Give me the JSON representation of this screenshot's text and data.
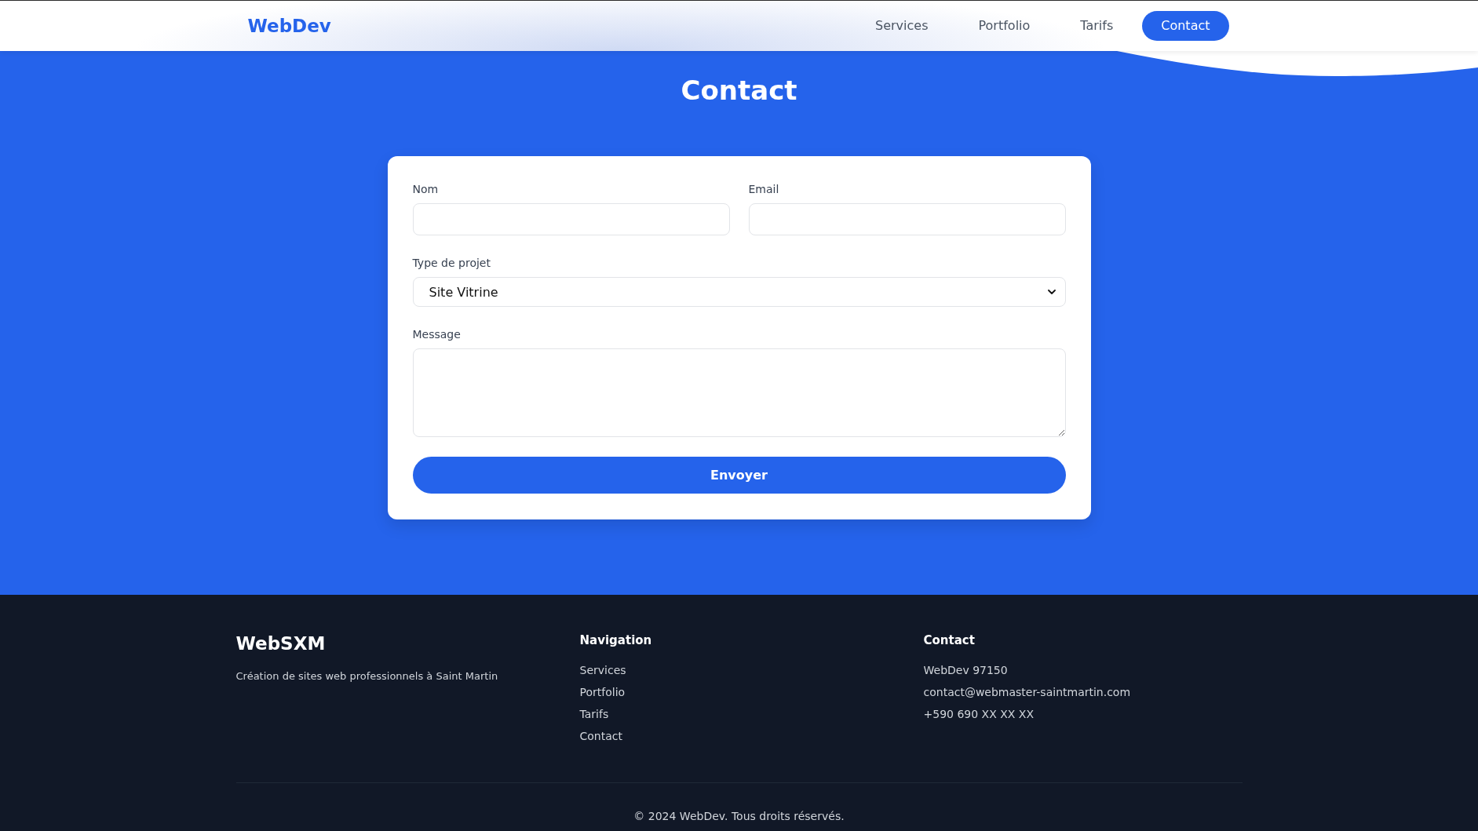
{
  "header": {
    "logo": "WebDev",
    "nav": [
      {
        "label": "Services",
        "selected": false
      },
      {
        "label": "Portfolio",
        "selected": false
      },
      {
        "label": "Tarifs",
        "selected": false
      },
      {
        "label": "Contact",
        "selected": true
      }
    ]
  },
  "page_title": "Contact",
  "form": {
    "fields": [
      {
        "kind": "text",
        "label": "Nom"
      },
      {
        "kind": "text",
        "label": "Email"
      },
      {
        "kind": "select",
        "label": "Type de projet",
        "value": "Site Vitrine"
      },
      {
        "kind": "textarea",
        "label": "Message"
      }
    ],
    "submit": "Envoyer"
  },
  "footer": {
    "brand": {
      "name": "WebSXM",
      "tagline": "Création de sites web professionnels à Saint Martin"
    },
    "columns": [
      {
        "heading": "Navigation",
        "items": [
          "Services",
          "Portfolio",
          "Tarifs",
          "Contact"
        ]
      },
      {
        "heading": "Contact",
        "items": [
          "WebDev 97150",
          "contact@webmaster-saintmartin.com",
          "+590 690 XX XX XX"
        ]
      }
    ],
    "copyright": "© 2024 WebDev. Tous droits réservés."
  }
}
